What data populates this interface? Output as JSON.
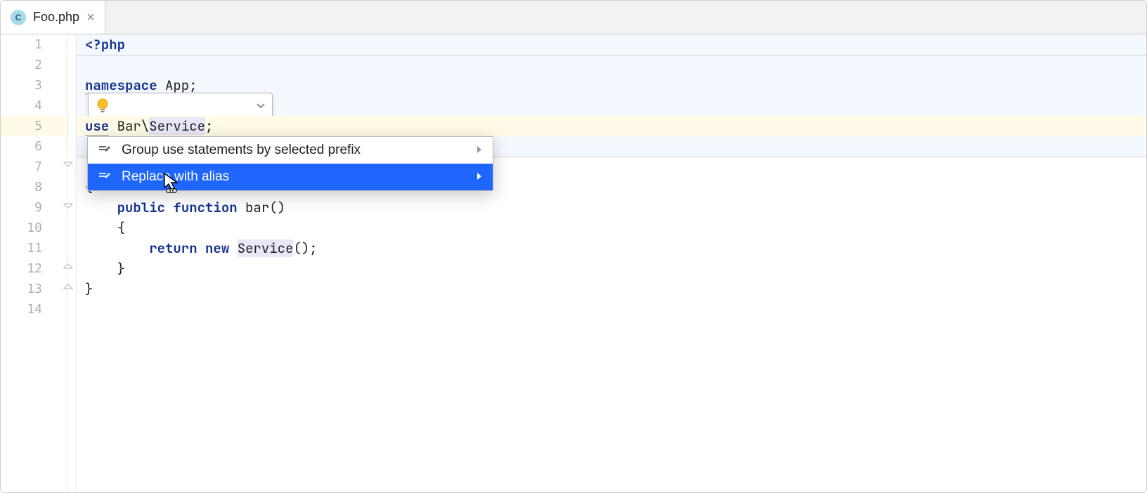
{
  "tab": {
    "filetype_badge": "C",
    "filename": "Foo.php"
  },
  "gutter": {
    "lines": [
      "1",
      "2",
      "3",
      "4",
      "5",
      "6",
      "7",
      "8",
      "9",
      "10",
      "11",
      "12",
      "13",
      "14"
    ]
  },
  "code": {
    "l1": {
      "open": "<?php"
    },
    "l3": {
      "kw": "namespace",
      "rest": " App;"
    },
    "l5": {
      "kw": "use",
      "seg1": " Bar\\",
      "seg2": "Service",
      "tail": ";"
    },
    "l8": {
      "text": "{"
    },
    "l9": {
      "vis": "public",
      "fn": "function",
      "name": " bar()"
    },
    "l10": {
      "text": "    {"
    },
    "l11": {
      "ret": "return",
      "new": "new",
      "cls": "Service",
      "tail": "();"
    },
    "l12": {
      "text": "    }"
    },
    "l13": {
      "text": "}"
    }
  },
  "intention": {
    "items": [
      {
        "label": "Group use statements by selected prefix"
      },
      {
        "label": "Replace with alias"
      }
    ]
  }
}
